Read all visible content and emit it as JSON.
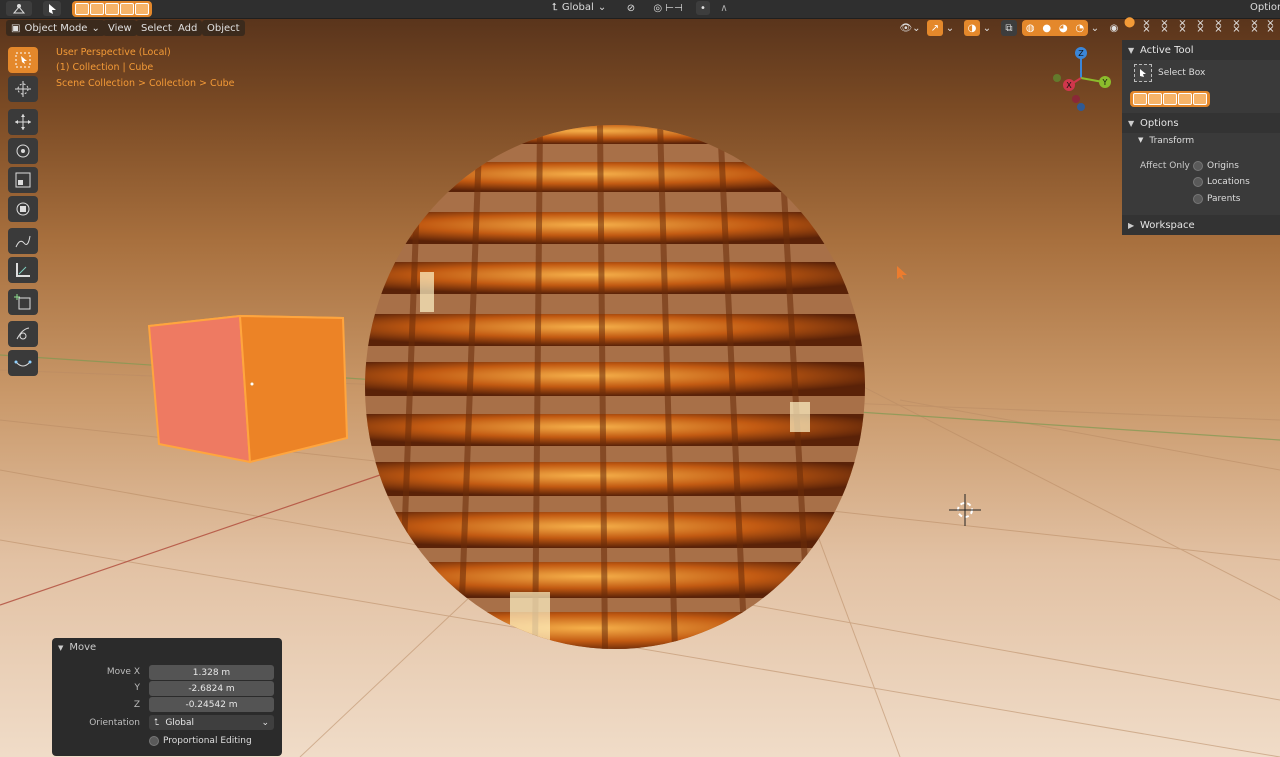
{
  "topbar": {
    "transform_orientation": "Global",
    "options_label": "Options"
  },
  "header": {
    "mode": "Object Mode",
    "menus": [
      "View",
      "Select",
      "Add",
      "Object"
    ]
  },
  "viewport_info": {
    "line1": "User Perspective (Local)",
    "line2": "(1) Collection | Cube",
    "breadcrumb": "Scene Collection  >  Collection  >  Cube"
  },
  "gizmo": {
    "x": "X",
    "y": "Y",
    "z": "Z"
  },
  "npanel": {
    "active_tool_title": "Active Tool",
    "tool_name": "Select Box",
    "options_title": "Options",
    "transform_title": "Transform",
    "affect_only_label": "Affect Only",
    "affect_only_items": [
      "Origins",
      "Locations",
      "Parents"
    ],
    "workspace_title": "Workspace"
  },
  "operator": {
    "title": "Move",
    "move_x_label": "Move X",
    "move_x": "1.328 m",
    "y_label": "Y",
    "y": "-2.6824 m",
    "z_label": "Z",
    "z": "-0.24542 m",
    "orientation_label": "Orientation",
    "orientation": "Global",
    "proportional_editing": "Proportional Editing"
  },
  "colors": {
    "accent": "#e4882b",
    "overlay_text": "#f39a37",
    "panel_bg": "#3a3a3a",
    "operator_bg": "#2b2b2b"
  }
}
